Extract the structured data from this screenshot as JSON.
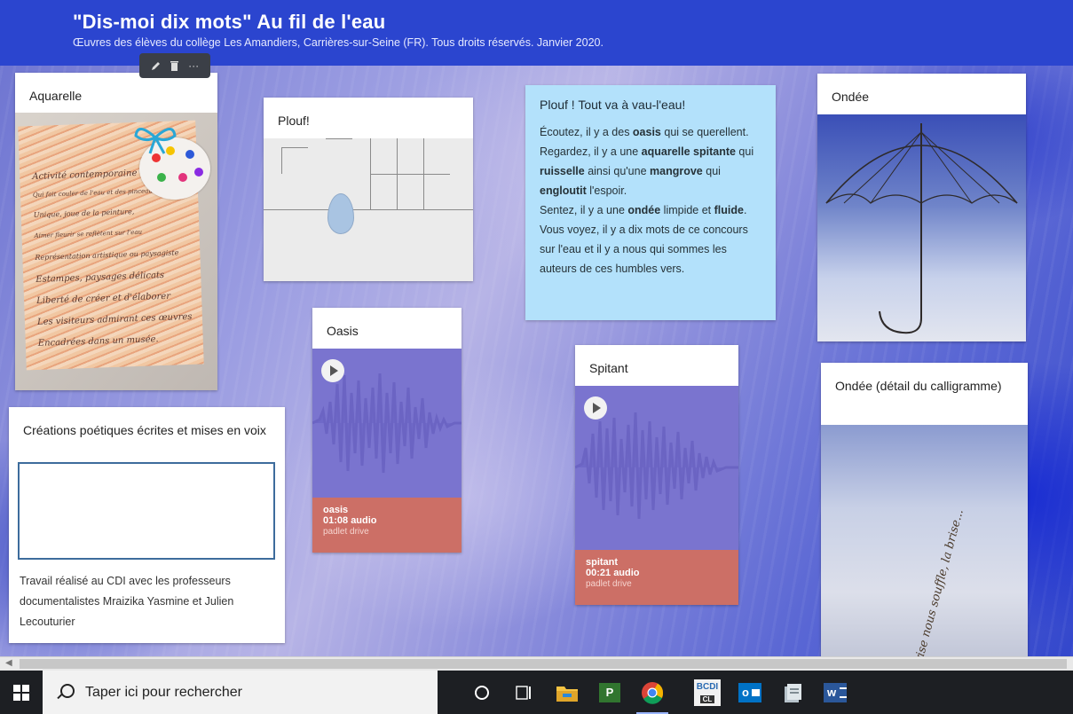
{
  "header": {
    "title": "\"Dis-moi dix mots\" Au fil de l'eau",
    "subtitle": "Œuvres des élèves du collège Les Amandiers, Carrières-sur-Seine (FR). Tous droits réservés. Janvier 2020."
  },
  "toolbar": {
    "edit_icon": "pencil-icon",
    "delete_icon": "trash-icon",
    "more_label": "···"
  },
  "cards": {
    "aquarelle": {
      "title": "Aquarelle"
    },
    "plouf": {
      "title": "Plouf!"
    },
    "oasis": {
      "title": "Oasis",
      "audio_name": "oasis",
      "audio_meta": "01:08 audio",
      "audio_source": "padlet drive"
    },
    "spitant": {
      "title": "Spitant",
      "audio_name": "spitant",
      "audio_meta": "00:21 audio",
      "audio_source": "padlet drive"
    },
    "ondee": {
      "title": "Ondée"
    },
    "ondee_detail": {
      "title": "Ondée (détail du calligramme)"
    },
    "creations": {
      "title": "Créations poétiques écrites et mises en voix",
      "body": "Travail réalisé au CDI avec les professeurs documentalistes Mraizika Yasmine et Julien Lecouturier"
    }
  },
  "note": {
    "title": "Plouf ! Tout va à vau-l'eau!",
    "segments": [
      {
        "t": "Écoutez, il y a des "
      },
      {
        "t": "oasis",
        "b": true
      },
      {
        "t": " qui se querellent. Regardez, il y a une "
      },
      {
        "t": "aquarelle spitante",
        "b": true
      },
      {
        "t": " qui "
      },
      {
        "t": "ruisselle",
        "b": true
      },
      {
        "t": " ainsi qu'une "
      },
      {
        "t": "mangrove",
        "b": true
      },
      {
        "t": " qui "
      },
      {
        "t": "engloutit",
        "b": true
      },
      {
        "t": " l'espoir.\nSentez, il y a une "
      },
      {
        "t": "ondée",
        "b": true
      },
      {
        "t": " limpide et "
      },
      {
        "t": "fluide",
        "b": true
      },
      {
        "t": ".\nVous voyez, il y a dix mots de ce concours sur l'eau et il y a nous qui sommes les auteurs de ces humbles vers."
      }
    ]
  },
  "acrostic": [
    "Activité contemporaine",
    "Qui fait couler de l'eau et des pinceaux",
    "Unique, joue de la peinture,",
    "Aimer fleurir se reflètent sur l'eau",
    "Représentation artistique ou paysagiste",
    "Estampes, paysages délicats",
    "Liberté de créer et d'élaborer",
    "Les visiteurs admirant ces œuvres",
    "Encadrées dans un musée."
  ],
  "calligram_text": "...la brise nous souffle, la brise...",
  "taskbar": {
    "search_placeholder": "Taper ici pour rechercher",
    "icons": [
      "start-icon",
      "cortana-icon",
      "task-view-icon",
      "file-explorer-icon",
      "project-icon",
      "chrome-icon",
      "bcdi-icon",
      "outlook-icon",
      "file-manager-icon",
      "word-icon"
    ],
    "bcdi_label": "BCDI",
    "bcdi_sub": "CL",
    "outlook_label": "o",
    "project_label": "P",
    "word_label": "w"
  }
}
